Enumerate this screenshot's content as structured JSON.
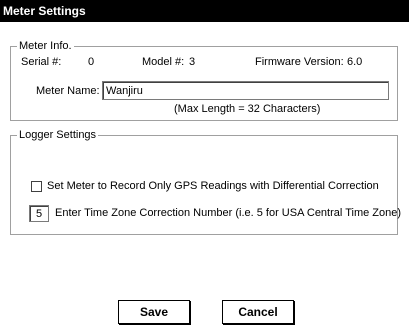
{
  "window": {
    "title": "Meter Settings"
  },
  "meter_info": {
    "legend": "Meter Info.",
    "serial_label": "Serial #:",
    "serial_value": "0",
    "model_label": "Model #:",
    "model_value": "3",
    "firmware_label": "Firmware Version:",
    "firmware_value": "6.0",
    "name_label": "Meter Name:",
    "name_value": "Wanjiru",
    "max_length_note": "(Max Length = 32 Characters)"
  },
  "logger_settings": {
    "legend": "Logger Settings",
    "gps_checkbox_label": "Set Meter to Record Only GPS Readings with Differential Correction",
    "gps_checkbox_checked": false,
    "timezone_value": "5",
    "timezone_label": "Enter Time Zone Correction Number (i.e. 5 for USA Central Time Zone)"
  },
  "buttons": {
    "save": "Save",
    "cancel": "Cancel"
  }
}
